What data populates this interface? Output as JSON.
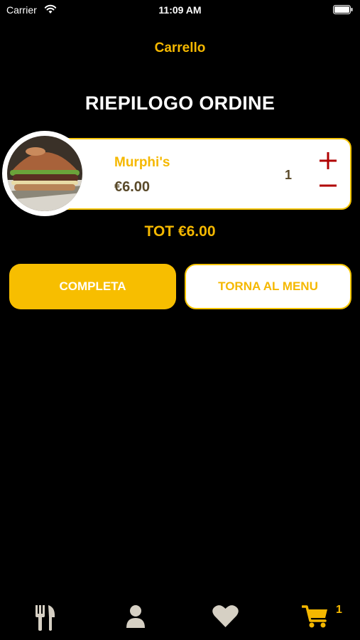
{
  "status_bar": {
    "carrier": "Carrier",
    "time": "11:09 AM"
  },
  "header": {
    "title": "Carrello"
  },
  "summary": {
    "title": "RIEPILOGO ORDINE"
  },
  "cart_item": {
    "name": "Murphi's",
    "price": "€6.00",
    "quantity": "1",
    "plus_symbol": "+",
    "minus_symbol": "−"
  },
  "total": {
    "label": "TOT €6.00"
  },
  "actions": {
    "complete_label": "COMPLETA",
    "back_label": "TORNA AL MENU"
  },
  "tab_bar": {
    "items": [
      {
        "icon": "fork-knife-icon",
        "active": false
      },
      {
        "icon": "user-icon",
        "active": false
      },
      {
        "icon": "heart-icon",
        "active": false
      },
      {
        "icon": "cart-icon",
        "active": true
      }
    ],
    "cart_badge": "1"
  },
  "colors": {
    "accent": "#f5b800",
    "background": "#000000",
    "minus_plus": "#b00000",
    "inactive_icon": "#d6d0c4"
  }
}
